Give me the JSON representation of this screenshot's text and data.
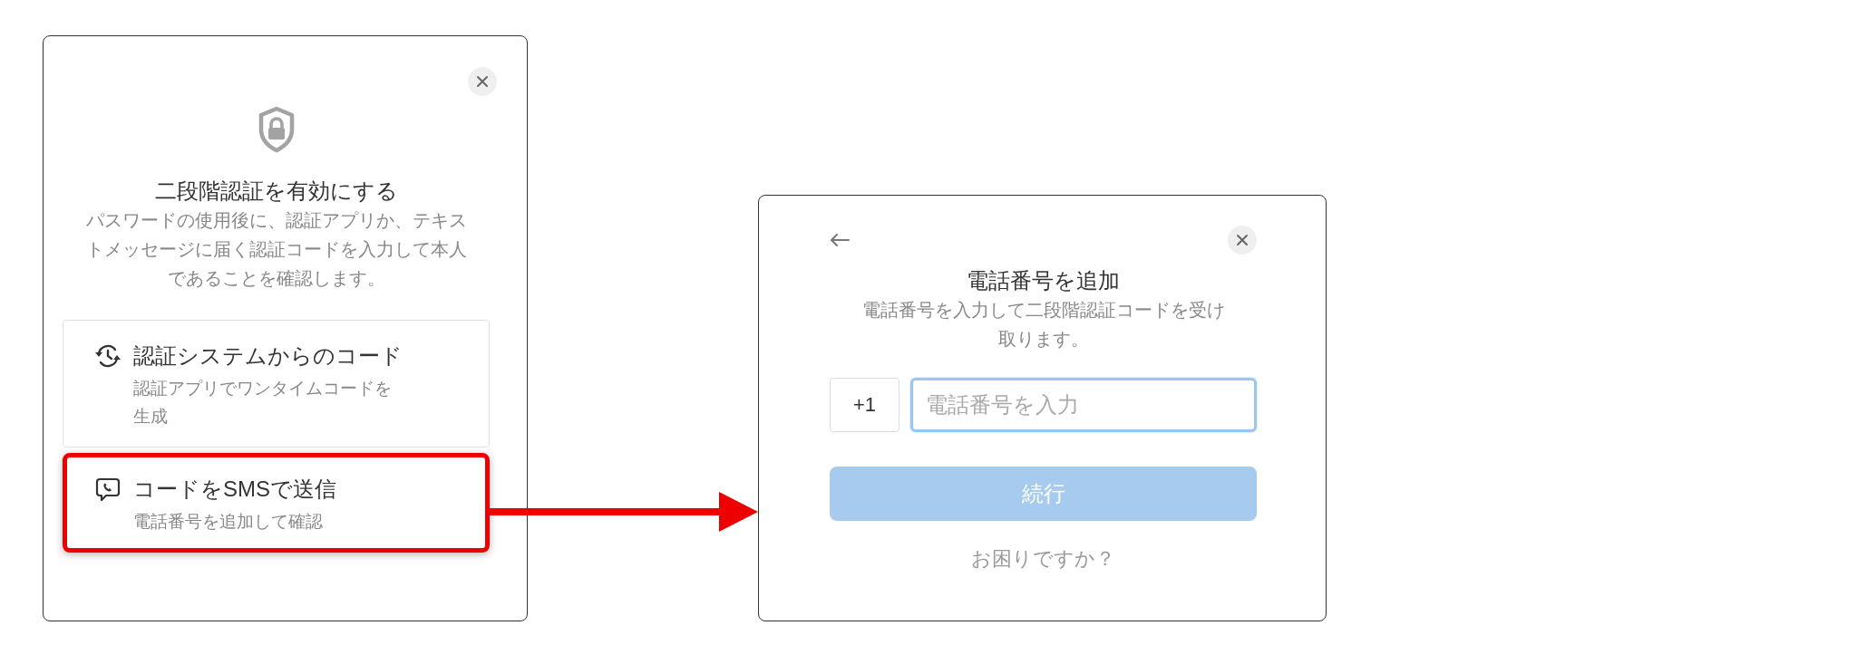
{
  "left_dialog": {
    "title": "二段階認証を有効にする",
    "description": "パスワードの使用後に、認証アプリか、テキストメッセージに届く認証コードを入力して本人であることを確認します。",
    "options": [
      {
        "kind": "authenticator",
        "title": "認証システムからのコード",
        "subtitle": "認証アプリでワンタイムコードを生成",
        "highlighted": false
      },
      {
        "kind": "sms",
        "title": "コードをSMSで送信",
        "subtitle": "電話番号を追加して確認",
        "highlighted": true
      }
    ]
  },
  "right_dialog": {
    "title": "電話番号を追加",
    "description": "電話番号を入力して二段階認証コードを受け取ります。",
    "country_code": "+1",
    "phone_field": {
      "placeholder": "電話番号を入力",
      "focused": true
    },
    "continue_button": {
      "label": "続行",
      "disabled": true
    },
    "help_link": "お困りですか？"
  }
}
